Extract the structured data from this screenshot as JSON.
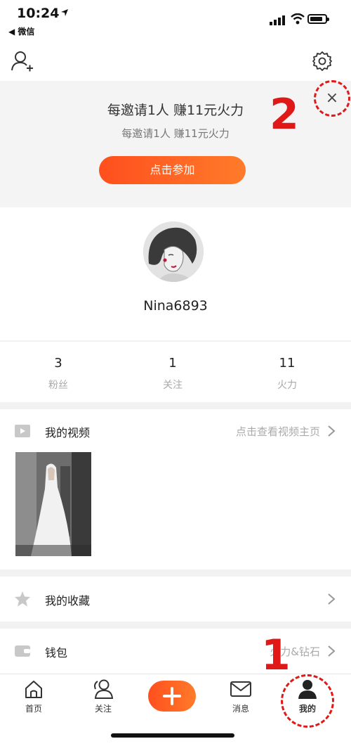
{
  "status_bar": {
    "time": "10:24",
    "back_app": "◀ 微信"
  },
  "banner": {
    "title": "每邀请1人 赚11元火力",
    "subtitle": "每邀请1人 赚11元火力",
    "join_label": "点击参加",
    "close_symbol": "×"
  },
  "annotations": {
    "close_marker": "2",
    "me_marker": "1",
    "marker_color": "#e01818"
  },
  "profile": {
    "username": "Nina6893"
  },
  "stats": [
    {
      "value": "3",
      "label": "粉丝"
    },
    {
      "value": "1",
      "label": "关注"
    },
    {
      "value": "11",
      "label": "火力"
    }
  ],
  "rows": {
    "videos": {
      "label": "我的视频",
      "right_text": "点击查看视频主页",
      "icon": "video-icon"
    },
    "favorites": {
      "label": "我的收藏",
      "icon": "star-icon"
    },
    "wallet": {
      "label": "钱包",
      "right_text": "火力&钻石",
      "icon": "wallet-icon"
    }
  },
  "nav": {
    "items": [
      {
        "label": "首页",
        "icon": "home-icon"
      },
      {
        "label": "关注",
        "icon": "follow-icon"
      },
      {
        "label": "",
        "icon": "plus-icon"
      },
      {
        "label": "消息",
        "icon": "message-icon"
      },
      {
        "label": "我的",
        "icon": "me-icon"
      }
    ]
  },
  "colors": {
    "accent": "#ff5a1f",
    "banner_bg": "#f4f4f4",
    "divider": "#f2f2f2"
  }
}
